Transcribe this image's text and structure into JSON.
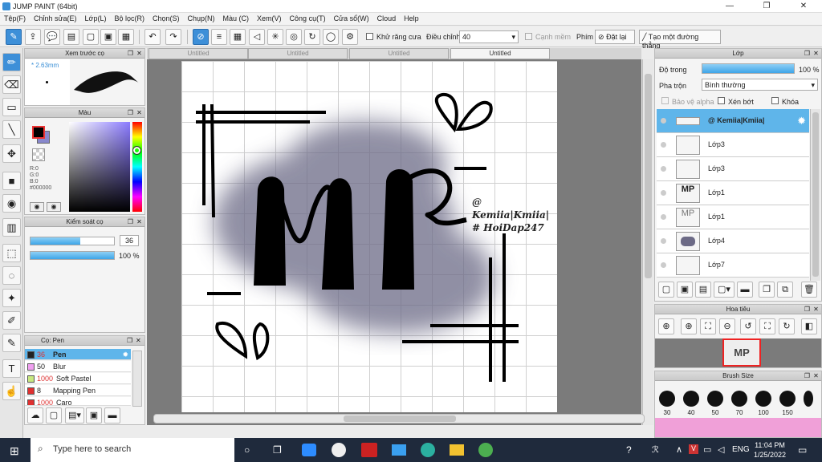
{
  "window": {
    "title": "JUMP PAINT (64bit)"
  },
  "menu": [
    "Tệp(F)",
    "Chỉnh sửa(E)",
    "Lớp(L)",
    "Bộ lọc(R)",
    "Chọn(S)",
    "Chụp(N)",
    "Màu (C)",
    "Xem(V)",
    "Công cụ(T)",
    "Cửa sổ(W)",
    "Cloud",
    "Help"
  ],
  "toolbar": {
    "antialias_label": "Khử răng cưa",
    "adjust_label": "Điều chỉnh",
    "adjust_value": "40",
    "smooth_label": "Cạnh mềm",
    "pen_label": "Phím",
    "reset_label": "Đặt lại",
    "straight_label": "Tạo một đường thẳng"
  },
  "brush_preview": {
    "title": "Xem trước cọ",
    "size": "2.63mm"
  },
  "color_panel": {
    "title": "Màu",
    "r": "R:0",
    "g": "G:0",
    "b": "B:0",
    "hex": "#000000",
    "primary_color": "#000000",
    "secondary_color": "#8888cc"
  },
  "brush_control": {
    "title": "Kiểm soát cọ",
    "size": "36",
    "opacity": "100 %",
    "size_fraction": 0.6,
    "opacity_fraction": 1.0
  },
  "brush_list": {
    "title": "Cọ: Pen",
    "items": [
      {
        "size": "36",
        "name": "Pen",
        "color": "#222222",
        "selected": true
      },
      {
        "size": "50",
        "name": "Blur",
        "color": "#f0a0f0"
      },
      {
        "size": "1000",
        "name": "Soft Pastel",
        "color": "#c8e880"
      },
      {
        "size": "8",
        "name": "Mapping Pen",
        "color": "#e03030"
      },
      {
        "size": "1000",
        "name": "Caro",
        "color": "#e03030"
      }
    ]
  },
  "doc_tabs": [
    "Untitled",
    "Untitled",
    "Untitled",
    "Untitled"
  ],
  "canvas_text": {
    "watermark1": "@ Kemiia|Kmiia|",
    "watermark2": "# HoiDap247",
    "letters": "MP"
  },
  "layers": {
    "title": "Lớp",
    "opacity_label": "Độ trong",
    "opacity_value": "100 %",
    "blend_label": "Pha trộn",
    "blend_value": "Bình thường",
    "protect_alpha": "Bảo vệ alpha",
    "clip": "Xén bớt",
    "lock": "Khóa",
    "items": [
      {
        "name": "@ Kemiia|Kmiia|",
        "selected": true
      },
      {
        "name": "Lớp3"
      },
      {
        "name": "Lớp3"
      },
      {
        "name": "Lớp1"
      },
      {
        "name": "Lớp1"
      },
      {
        "name": "Lớp4"
      },
      {
        "name": "Lớp7"
      }
    ]
  },
  "navigator": {
    "title": "Hoa tiêu"
  },
  "brush_size": {
    "title": "Brush Size",
    "labels": [
      "30",
      "40",
      "50",
      "70",
      "100",
      "150"
    ]
  },
  "taskbar": {
    "search_placeholder": "Type here to search",
    "time": "11:04 PM",
    "date": "1/25/2022",
    "lang": "ENG"
  }
}
